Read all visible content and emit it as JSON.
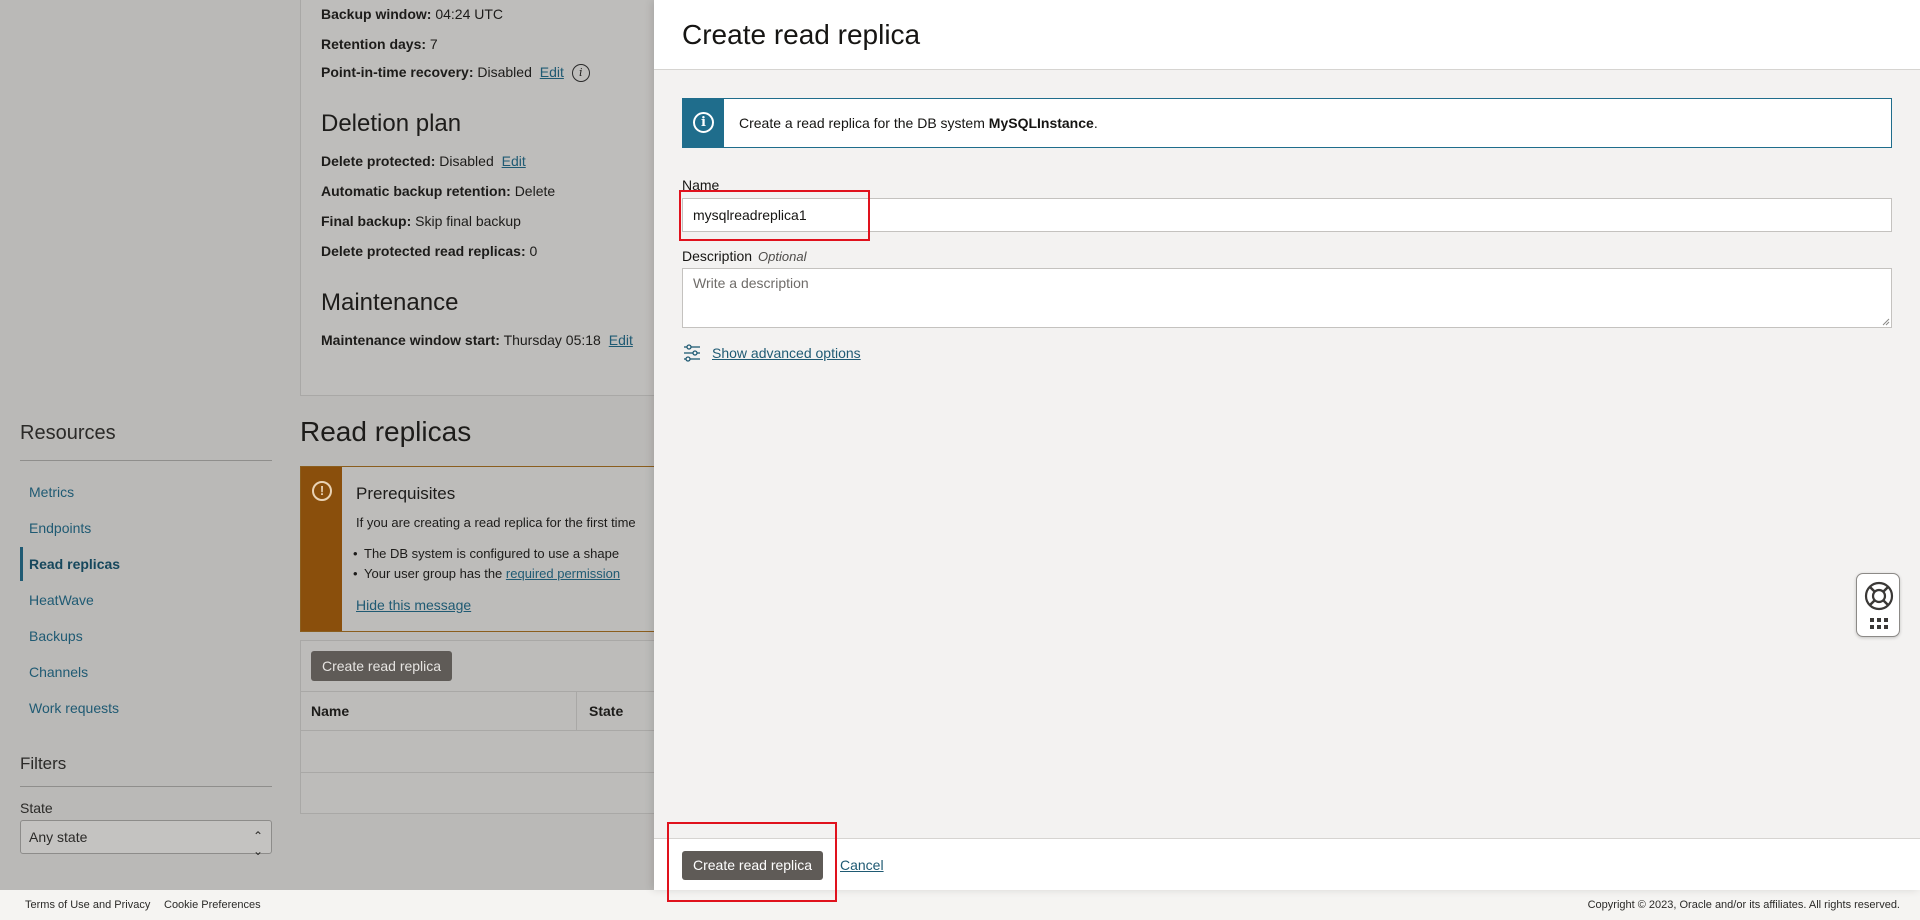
{
  "background": {
    "backup": {
      "backup_window_label": "Backup window:",
      "backup_window_value": "04:24 UTC",
      "retention_label": "Retention days:",
      "retention_value": "7",
      "pitr_label": "Point-in-time recovery:",
      "pitr_value": "Disabled",
      "pitr_edit": "Edit"
    },
    "deletion_plan": {
      "title": "Deletion plan",
      "delete_protected_label": "Delete protected:",
      "delete_protected_value": "Disabled",
      "delete_protected_edit": "Edit",
      "auto_backup_label": "Automatic backup retention:",
      "auto_backup_value": "Delete",
      "final_backup_label": "Final backup:",
      "final_backup_value": "Skip final backup",
      "delete_protected_replicas_label": "Delete protected read replicas:",
      "delete_protected_replicas_value": "0"
    },
    "maintenance": {
      "title": "Maintenance",
      "window_label": "Maintenance window start:",
      "window_value": "Thursday 05:18",
      "window_edit": "Edit"
    },
    "resources": {
      "title": "Resources",
      "items": [
        {
          "label": "Metrics"
        },
        {
          "label": "Endpoints"
        },
        {
          "label": "Read replicas",
          "active": true
        },
        {
          "label": "HeatWave"
        },
        {
          "label": "Backups"
        },
        {
          "label": "Channels"
        },
        {
          "label": "Work requests"
        }
      ]
    },
    "filters": {
      "title": "Filters",
      "state_label": "State",
      "state_value": "Any state"
    },
    "read_replicas": {
      "title": "Read replicas",
      "prereq_title": "Prerequisites",
      "prereq_text": "If you are creating a read replica for the first time",
      "prereq_bullet1": "The DB system is configured to use a shape",
      "prereq_bullet2_prefix": "Your user group has the ",
      "prereq_bullet2_link": "required permission",
      "hide_message": "Hide this message",
      "create_button": "Create read replica",
      "col_name": "Name",
      "col_state": "State"
    },
    "footer": {
      "terms": "Terms of Use and Privacy",
      "cookies": "Cookie Preferences",
      "copyright": "Copyright © 2023, Oracle and/or its affiliates. All rights reserved."
    }
  },
  "drawer": {
    "title": "Create read replica",
    "notice_prefix": "Create a read replica for the DB system ",
    "notice_db": "MySQLInstance",
    "notice_suffix": ".",
    "name_label": "Name",
    "name_value": "mysqlreadreplica1",
    "description_label": "Description",
    "description_optional": "Optional",
    "description_placeholder": "Write a description",
    "advanced_options": "Show advanced options",
    "submit_button": "Create read replica",
    "cancel": "Cancel"
  },
  "colors": {
    "accent_link": "#1f5a73",
    "info_blue": "#1f6d8c",
    "warning_brown": "#8a4f0c",
    "primary_button": "#5f5b57",
    "highlight_red": "#e0121d"
  }
}
